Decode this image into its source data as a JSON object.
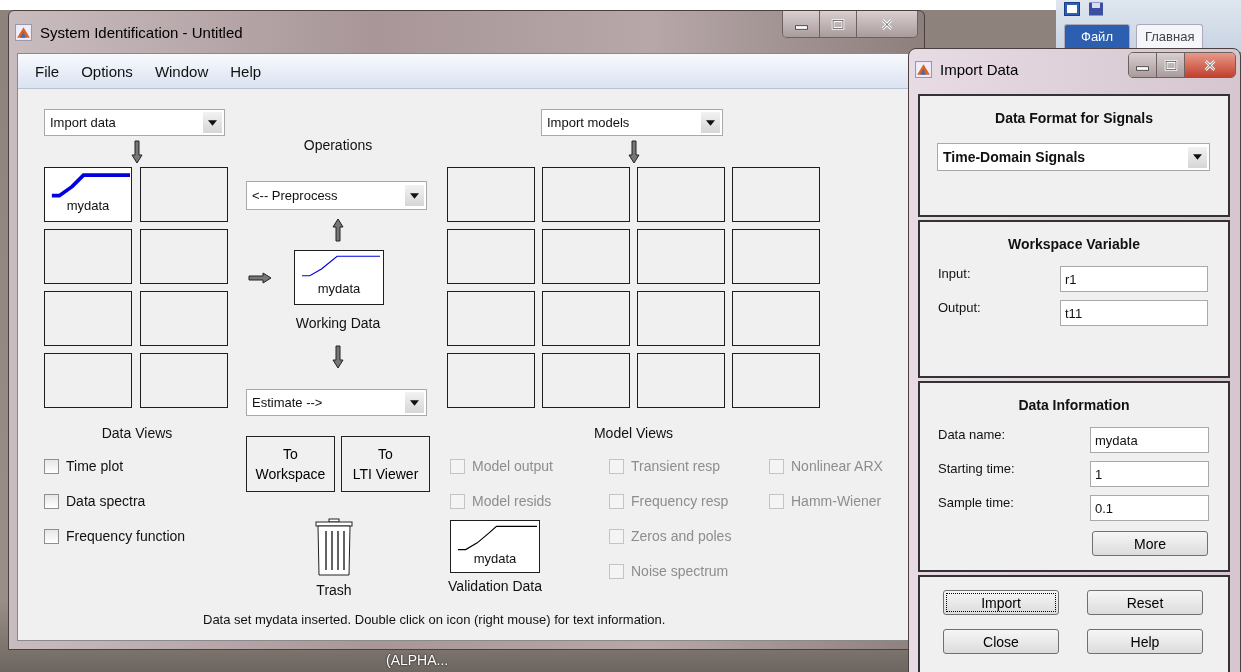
{
  "background": {
    "tabs": [
      {
        "label": "Файл",
        "selected": true
      },
      {
        "label": "Главная",
        "selected": false
      }
    ],
    "desktop_label": "(ALPHA..."
  },
  "window": {
    "title": "System Identification - Untitled"
  },
  "menu": [
    "File",
    "Options",
    "Window",
    "Help"
  ],
  "data_import": {
    "value": "Import data"
  },
  "data_cells": [
    {
      "kind": "data",
      "label": "mydata"
    },
    {
      "kind": "empty"
    },
    {
      "kind": "empty"
    },
    {
      "kind": "empty"
    },
    {
      "kind": "empty"
    },
    {
      "kind": "empty"
    },
    {
      "kind": "empty"
    },
    {
      "kind": "empty"
    }
  ],
  "data_views": {
    "title": "Data Views",
    "options": [
      {
        "label": "Time plot",
        "checked": false,
        "disabled": false
      },
      {
        "label": "Data spectra",
        "checked": false,
        "disabled": false
      },
      {
        "label": "Frequency function",
        "checked": false,
        "disabled": false
      }
    ]
  },
  "operations": {
    "title": "Operations",
    "preprocess": "<-- Preprocess",
    "working": {
      "label": "mydata",
      "caption": "Working Data"
    },
    "estimate": "Estimate -->",
    "buttons": [
      "To\nWorkspace",
      "To\nLTI Viewer"
    ],
    "trash": "Trash"
  },
  "model_import": {
    "value": "Import models"
  },
  "model_cells": [
    {
      "kind": "empty"
    },
    {
      "kind": "empty"
    },
    {
      "kind": "empty"
    },
    {
      "kind": "empty"
    },
    {
      "kind": "empty"
    },
    {
      "kind": "empty"
    },
    {
      "kind": "empty"
    },
    {
      "kind": "empty"
    },
    {
      "kind": "empty"
    },
    {
      "kind": "empty"
    },
    {
      "kind": "empty"
    },
    {
      "kind": "empty"
    },
    {
      "kind": "empty"
    },
    {
      "kind": "empty"
    },
    {
      "kind": "empty"
    },
    {
      "kind": "empty"
    }
  ],
  "model_views": {
    "title": "Model Views",
    "columns": [
      [
        {
          "label": "Model output",
          "checked": false,
          "disabled": true
        },
        {
          "label": "Model resids",
          "checked": false,
          "disabled": true
        }
      ],
      [
        {
          "label": "Transient resp",
          "checked": false,
          "disabled": true
        },
        {
          "label": "Frequency resp",
          "checked": false,
          "disabled": true
        },
        {
          "label": "Zeros and poles",
          "checked": false,
          "disabled": true
        },
        {
          "label": "Noise spectrum",
          "checked": false,
          "disabled": true
        }
      ],
      [
        {
          "label": "Nonlinear ARX",
          "checked": false,
          "disabled": true
        },
        {
          "label": "Hamm-Wiener",
          "checked": false,
          "disabled": true
        }
      ]
    ]
  },
  "validation": {
    "label": "mydata",
    "caption": "Validation Data"
  },
  "status": "Data set mydata inserted.  Double click on icon (right mouse) for text information.",
  "import_dialog": {
    "title": "Import Data",
    "format": {
      "title": "Data Format for Signals",
      "value": "Time-Domain Signals"
    },
    "workspace": {
      "title": "Workspace Variable",
      "fields": [
        {
          "label": "Input:",
          "value": "r1"
        },
        {
          "label": "Output:",
          "value": "t11"
        }
      ]
    },
    "info": {
      "title": "Data Information",
      "fields": [
        {
          "label": "Data name:",
          "value": "mydata"
        },
        {
          "label": "Starting time:",
          "value": "1"
        },
        {
          "label": "Sample time:",
          "value": "0.1"
        }
      ],
      "more": "More"
    },
    "buttons": [
      {
        "label": "Import",
        "focused": true
      },
      {
        "label": "Reset",
        "focused": false
      },
      {
        "label": "Close",
        "focused": false
      },
      {
        "label": "Help",
        "focused": false
      }
    ]
  }
}
